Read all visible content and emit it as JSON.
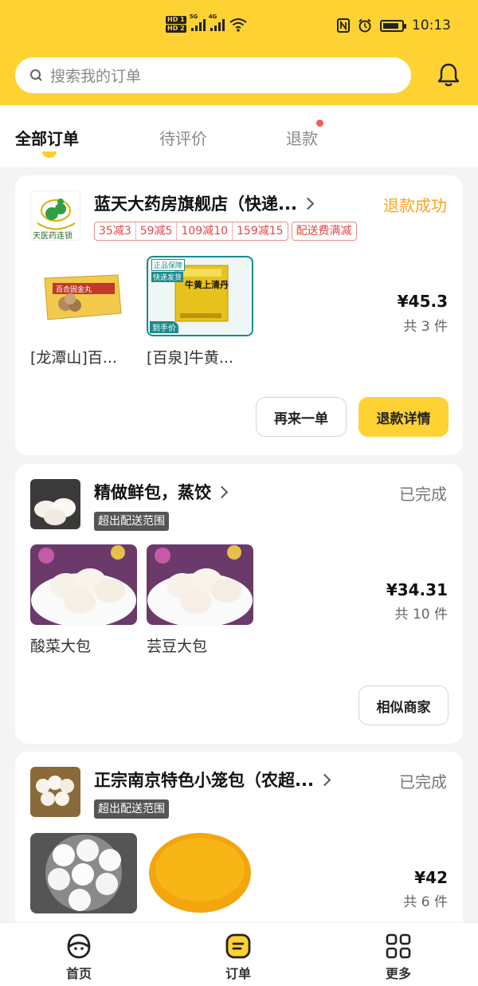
{
  "status_bar": {
    "time": "10:13",
    "network": "4G",
    "sim1": "HD 1",
    "sim2": "HD 2",
    "signal1_label": "5G",
    "signal2_label": "4G"
  },
  "search": {
    "placeholder": "搜索我的订单"
  },
  "tabs": [
    {
      "label": "全部订单",
      "active": true
    },
    {
      "label": "待评价",
      "active": false
    },
    {
      "label": "退款",
      "active": false,
      "badge_dot": true
    }
  ],
  "orders": [
    {
      "shop": "蓝天大药房旗舰店（快递...",
      "status": "退款成功",
      "status_color": "#f7a51f",
      "logo_text": "天医药连锁",
      "promos": [
        "35减3",
        "59减5",
        "109减10",
        "159减15"
      ],
      "promo_extra": "配送费满减",
      "items": [
        {
          "name": "[龙潭山]百...",
          "image_text": "百合固金丸"
        },
        {
          "name": "[百泉]牛黄...",
          "image_text": "牛黄上清丹",
          "badge_top1": "正品保障",
          "badge_top2": "快递发货",
          "badge_bottom": "到手价"
        }
      ],
      "price": "¥45.3",
      "count": "共 3 件",
      "buttons": [
        "再来一单",
        "退款详情"
      ]
    },
    {
      "shop": "精做鲜包，蒸饺",
      "status": "已完成",
      "status_color": "#777777",
      "badge": "超出配送范围",
      "items": [
        {
          "name": "酸菜大包"
        },
        {
          "name": "芸豆大包"
        }
      ],
      "price": "¥34.31",
      "count": "共 10 件",
      "buttons": [
        "相似商家"
      ]
    },
    {
      "shop": "正宗南京特色小笼包（农超...",
      "status": "已完成",
      "status_color": "#777777",
      "badge": "超出配送范围",
      "items": [
        {
          "name": ""
        },
        {
          "name": ""
        }
      ],
      "price": "¥42",
      "count": "共 6 件"
    }
  ],
  "bottom_nav": [
    {
      "label": "首页",
      "icon": "home-face-icon"
    },
    {
      "label": "订单",
      "icon": "order-icon",
      "active": true
    },
    {
      "label": "更多",
      "icon": "grid-icon"
    }
  ],
  "colors": {
    "brand_yellow": "#ffd233",
    "refund_orange": "#f7a51f",
    "promo_red": "#e04848"
  }
}
